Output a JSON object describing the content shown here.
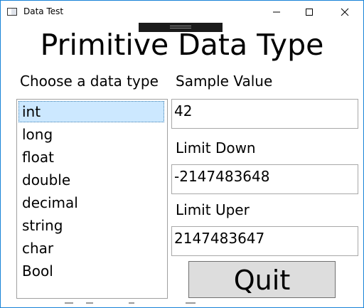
{
  "window": {
    "title": "Data Test",
    "icon": "app-window-icon",
    "controls": [
      "minimize-icon",
      "maximize-icon",
      "close-icon"
    ],
    "border_color": "#1883d7"
  },
  "page": {
    "title": "Primitive Data Type"
  },
  "labels": {
    "choose": "Choose a data type",
    "sample": "Sample Value",
    "limit_down": "Limit Down",
    "limit_up": "Limit Uper"
  },
  "list": {
    "items": [
      "int",
      "long",
      "float",
      "double",
      "decimal",
      "string",
      "char",
      "Bool"
    ],
    "selected": "int",
    "selection_color": "#cce8ff"
  },
  "fields": {
    "sample_value": "42",
    "limit_down": "-2147483648",
    "limit_up": "2147483647"
  },
  "buttons": {
    "quit": "Quit"
  }
}
